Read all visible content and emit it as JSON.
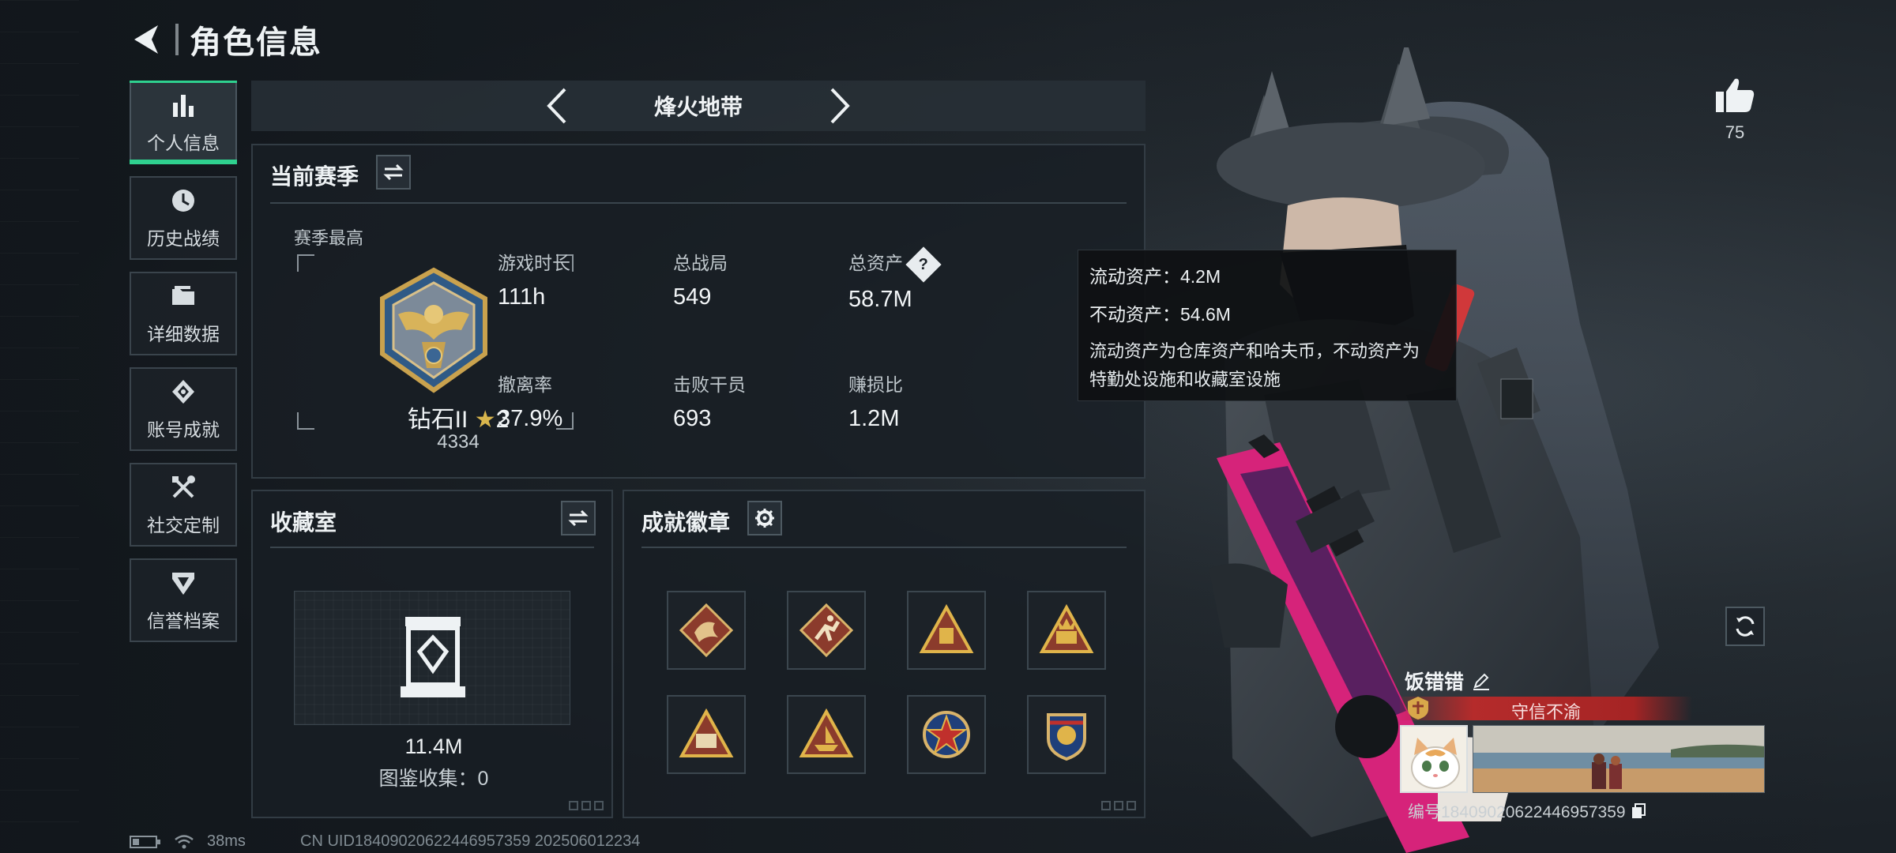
{
  "header": {
    "title": "角色信息"
  },
  "sidebar": {
    "items": [
      {
        "label": "个人信息",
        "icon": "bar-chart-icon",
        "active": true
      },
      {
        "label": "历史战绩",
        "icon": "clock-icon",
        "active": false
      },
      {
        "label": "详细数据",
        "icon": "folder-icon",
        "active": false
      },
      {
        "label": "账号成就",
        "icon": "achievement-icon",
        "active": false
      },
      {
        "label": "社交定制",
        "icon": "tools-icon",
        "active": false
      },
      {
        "label": "信誉档案",
        "icon": "shield-icon",
        "active": false
      }
    ]
  },
  "mode": {
    "title": "烽火地带"
  },
  "season": {
    "title": "当前赛季",
    "best_label": "赛季最高",
    "rank_name": "钻石II",
    "rank_stars": "2",
    "rank_score": "4334",
    "stats": [
      {
        "label": "游戏时长",
        "value": "111h"
      },
      {
        "label": "总战局",
        "value": "549"
      },
      {
        "label": "总资产",
        "value": "58.7M"
      },
      {
        "label": "撤离率",
        "value": "37.9%"
      },
      {
        "label": "击败干员",
        "value": "693"
      },
      {
        "label": "赚损比",
        "value": "1.2M"
      }
    ],
    "help_symbol": "?"
  },
  "tooltip": {
    "liquid": "流动资产：4.2M",
    "fixed": "不动资产：54.6M",
    "desc1": "流动资产为仓库资产和哈夫币，不动资产为",
    "desc2": "特勤处设施和收藏室设施"
  },
  "collection": {
    "title": "收藏室",
    "value": "11.4M",
    "count": "图鉴收集：0"
  },
  "badges": {
    "title": "成就徽章",
    "items": [
      "dragon-badge-icon",
      "runner-badge-icon",
      "gold-triangle-badge-icon",
      "fifty-triangle-badge-icon",
      "fifty-b-triangle-badge-icon",
      "ship-triangle-badge-icon",
      "star-round-badge-icon",
      "shield-round-badge-icon"
    ]
  },
  "likes": {
    "count": "75"
  },
  "profile": {
    "name": "饭错错",
    "honor": "守信不渝",
    "id": "编号1840902062244695735​9"
  },
  "status": {
    "ping": "38ms",
    "uid": "CN UID1840902062244695735​9 20250601223​4"
  },
  "colors": {
    "accent": "#2fd18f",
    "ribbon": "#b52b2b",
    "panel": "#181e24"
  }
}
